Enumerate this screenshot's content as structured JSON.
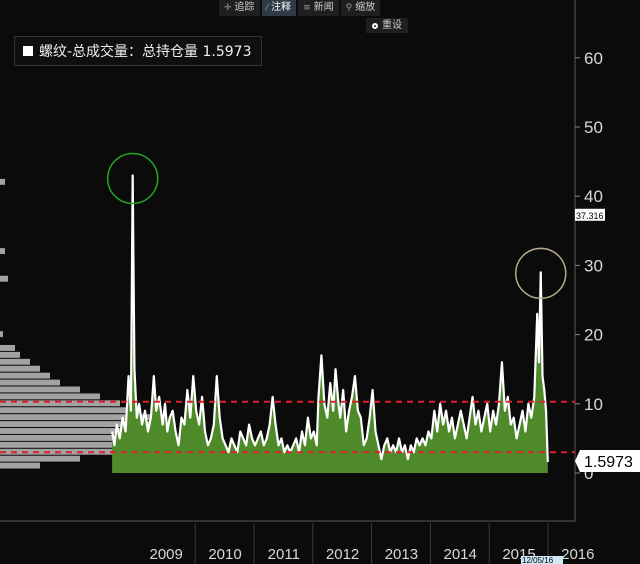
{
  "toolbar": {
    "items": [
      {
        "label": "追踪",
        "icon": "crosshair-icon",
        "glyph": "✛"
      },
      {
        "label": "注释",
        "icon": "pencil-icon",
        "glyph": "⁄"
      },
      {
        "label": "新闻",
        "icon": "news-icon",
        "glyph": "≡"
      },
      {
        "label": "缩放",
        "icon": "magnifier-icon",
        "glyph": "⚲"
      }
    ],
    "active_index": 1,
    "reset_label": "重设"
  },
  "legend": {
    "text": "螺纹-总成交量：总持仓量 1.5973"
  },
  "colors": {
    "line": "#ffffff",
    "area": "#4e8a2a",
    "ref_line": "#e0202a",
    "profile": "#bdbdbd",
    "grid_divider": "#3a3a3a",
    "circle_left": "#1faa1f",
    "circle_right": "#b5ad8a"
  },
  "chart_data": {
    "type": "area",
    "title": "",
    "xlabel": "",
    "ylabel": "",
    "ylim": [
      -7,
      66
    ],
    "y_ticks": [
      0,
      10,
      20,
      30,
      40,
      50,
      60
    ],
    "x_labels": [
      "2009",
      "2010",
      "2011",
      "2012",
      "2013",
      "2014",
      "2015",
      "2016"
    ],
    "x_range": [
      2008.9,
      2016.5
    ],
    "reference_lines": [
      10.3,
      3.0
    ],
    "last_value_label": "1.5973",
    "marker_label": "37.316",
    "marker_value": 37.316,
    "date_label": "12/05/16",
    "series": [
      {
        "values": [
          [
            2008.92,
            6
          ],
          [
            2008.96,
            4
          ],
          [
            2009.0,
            7
          ],
          [
            2009.05,
            5
          ],
          [
            2009.1,
            8
          ],
          [
            2009.15,
            6
          ],
          [
            2009.2,
            14
          ],
          [
            2009.24,
            9
          ],
          [
            2009.27,
            43
          ],
          [
            2009.3,
            15
          ],
          [
            2009.34,
            8
          ],
          [
            2009.38,
            10
          ],
          [
            2009.43,
            7
          ],
          [
            2009.48,
            9
          ],
          [
            2009.53,
            6
          ],
          [
            2009.58,
            8
          ],
          [
            2009.63,
            14
          ],
          [
            2009.67,
            9
          ],
          [
            2009.72,
            11
          ],
          [
            2009.78,
            7
          ],
          [
            2009.82,
            10
          ],
          [
            2009.86,
            6
          ],
          [
            2009.9,
            8
          ],
          [
            2009.95,
            9
          ],
          [
            2010.0,
            6
          ],
          [
            2010.05,
            4
          ],
          [
            2010.1,
            8
          ],
          [
            2010.15,
            7
          ],
          [
            2010.2,
            12
          ],
          [
            2010.25,
            8
          ],
          [
            2010.3,
            14
          ],
          [
            2010.35,
            9
          ],
          [
            2010.4,
            7
          ],
          [
            2010.45,
            11
          ],
          [
            2010.5,
            6
          ],
          [
            2010.55,
            4
          ],
          [
            2010.6,
            5
          ],
          [
            2010.65,
            7
          ],
          [
            2010.7,
            14
          ],
          [
            2010.75,
            8
          ],
          [
            2010.8,
            5
          ],
          [
            2010.85,
            4
          ],
          [
            2010.9,
            3
          ],
          [
            2010.95,
            5
          ],
          [
            2011.0,
            4
          ],
          [
            2011.05,
            3
          ],
          [
            2011.1,
            6
          ],
          [
            2011.15,
            5
          ],
          [
            2011.2,
            4
          ],
          [
            2011.25,
            7
          ],
          [
            2011.3,
            5
          ],
          [
            2011.35,
            4
          ],
          [
            2011.4,
            5
          ],
          [
            2011.45,
            6
          ],
          [
            2011.5,
            4
          ],
          [
            2011.55,
            5
          ],
          [
            2011.6,
            7
          ],
          [
            2011.65,
            11
          ],
          [
            2011.7,
            7
          ],
          [
            2011.75,
            4
          ],
          [
            2011.8,
            5
          ],
          [
            2011.85,
            3
          ],
          [
            2011.9,
            4
          ],
          [
            2011.95,
            3
          ],
          [
            2012.0,
            4
          ],
          [
            2012.05,
            5
          ],
          [
            2012.1,
            3
          ],
          [
            2012.15,
            6
          ],
          [
            2012.2,
            4
          ],
          [
            2012.25,
            8
          ],
          [
            2012.3,
            5
          ],
          [
            2012.35,
            6
          ],
          [
            2012.4,
            4
          ],
          [
            2012.43,
            11
          ],
          [
            2012.48,
            17
          ],
          [
            2012.53,
            10
          ],
          [
            2012.58,
            8
          ],
          [
            2012.63,
            13
          ],
          [
            2012.68,
            9
          ],
          [
            2012.72,
            15
          ],
          [
            2012.77,
            10
          ],
          [
            2012.8,
            8
          ],
          [
            2012.85,
            12
          ],
          [
            2012.9,
            6
          ],
          [
            2012.95,
            9
          ],
          [
            2013.0,
            11
          ],
          [
            2013.05,
            14
          ],
          [
            2013.1,
            9
          ],
          [
            2013.15,
            8
          ],
          [
            2013.2,
            4
          ],
          [
            2013.25,
            5
          ],
          [
            2013.3,
            8
          ],
          [
            2013.35,
            12
          ],
          [
            2013.4,
            6
          ],
          [
            2013.45,
            4
          ],
          [
            2013.5,
            2
          ],
          [
            2013.55,
            4
          ],
          [
            2013.6,
            5
          ],
          [
            2013.65,
            3
          ],
          [
            2013.7,
            4
          ],
          [
            2013.75,
            3
          ],
          [
            2013.8,
            5
          ],
          [
            2013.85,
            3
          ],
          [
            2013.9,
            4
          ],
          [
            2013.95,
            2
          ],
          [
            2014.0,
            4
          ],
          [
            2014.05,
            3
          ],
          [
            2014.1,
            5
          ],
          [
            2014.15,
            4
          ],
          [
            2014.2,
            5
          ],
          [
            2014.25,
            4
          ],
          [
            2014.3,
            6
          ],
          [
            2014.35,
            5
          ],
          [
            2014.4,
            9
          ],
          [
            2014.45,
            6
          ],
          [
            2014.5,
            10
          ],
          [
            2014.55,
            7
          ],
          [
            2014.6,
            9
          ],
          [
            2014.65,
            6
          ],
          [
            2014.7,
            8
          ],
          [
            2014.75,
            5
          ],
          [
            2014.8,
            7
          ],
          [
            2014.85,
            9
          ],
          [
            2014.9,
            7
          ],
          [
            2014.95,
            5
          ],
          [
            2015.0,
            8
          ],
          [
            2015.05,
            11
          ],
          [
            2015.1,
            7
          ],
          [
            2015.15,
            9
          ],
          [
            2015.2,
            6
          ],
          [
            2015.25,
            8
          ],
          [
            2015.3,
            10
          ],
          [
            2015.35,
            6
          ],
          [
            2015.4,
            9
          ],
          [
            2015.45,
            7
          ],
          [
            2015.5,
            10
          ],
          [
            2015.55,
            16
          ],
          [
            2015.6,
            9
          ],
          [
            2015.65,
            11
          ],
          [
            2015.7,
            7
          ],
          [
            2015.75,
            8
          ],
          [
            2015.8,
            5
          ],
          [
            2015.85,
            7
          ],
          [
            2015.9,
            9
          ],
          [
            2015.95,
            6
          ],
          [
            2016.0,
            10
          ],
          [
            2016.05,
            8
          ],
          [
            2016.1,
            11
          ],
          [
            2016.15,
            23
          ],
          [
            2016.18,
            16
          ],
          [
            2016.21,
            29
          ],
          [
            2016.24,
            14
          ],
          [
            2016.27,
            12
          ],
          [
            2016.3,
            9
          ],
          [
            2016.33,
            1.6
          ]
        ]
      }
    ],
    "volume_profile": [
      [
        20,
        0.3
      ],
      [
        18,
        1.5
      ],
      [
        17,
        2
      ],
      [
        16,
        3
      ],
      [
        15,
        4
      ],
      [
        14,
        5
      ],
      [
        13,
        6
      ],
      [
        12,
        8
      ],
      [
        11,
        10
      ],
      [
        10,
        12
      ],
      [
        9,
        14
      ],
      [
        8,
        15
      ],
      [
        7,
        16
      ],
      [
        6,
        17
      ],
      [
        5,
        16
      ],
      [
        4,
        14
      ],
      [
        3,
        12
      ],
      [
        2,
        8
      ],
      [
        1,
        4
      ],
      [
        28,
        0.8
      ],
      [
        32,
        0.5
      ],
      [
        42,
        0.5
      ]
    ]
  }
}
